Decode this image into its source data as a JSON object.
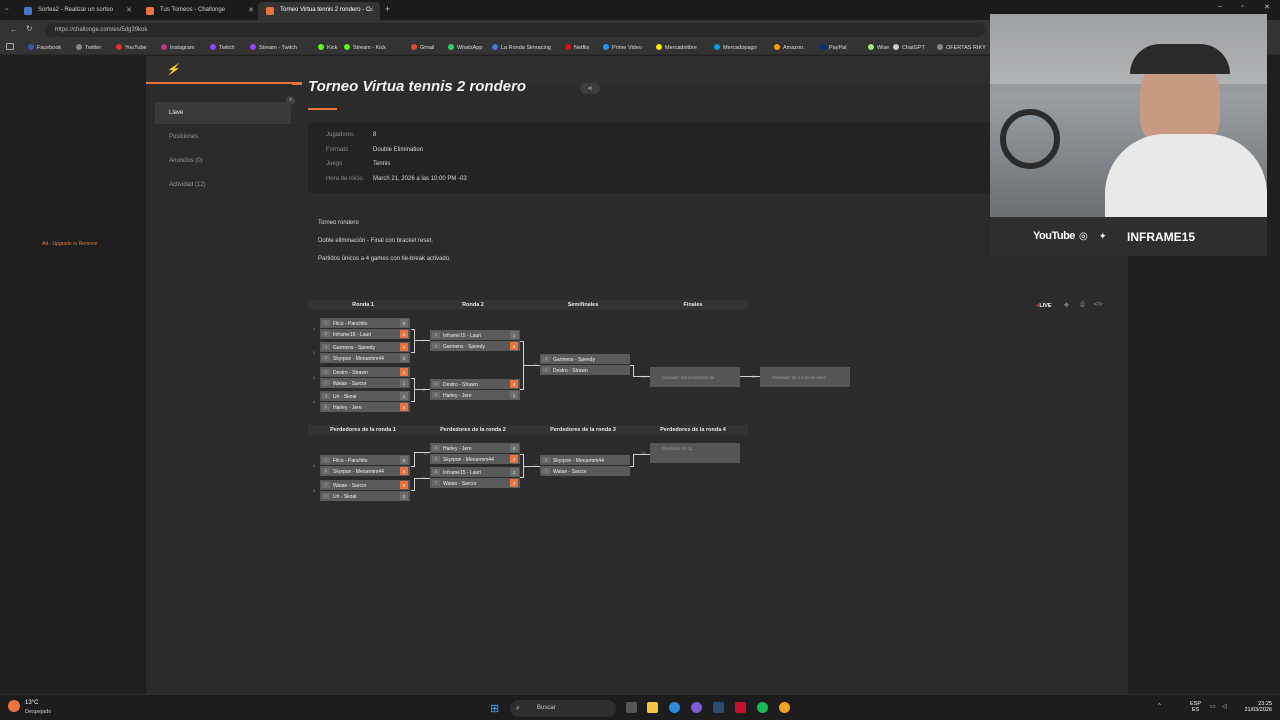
{
  "tabs": [
    {
      "label": "Sortea2 - Realizar un sorteo",
      "color": "#4a74c9"
    },
    {
      "label": "Tus Torneos - Challonge",
      "color": "#e8743b"
    },
    {
      "label": "Torneo Virtua tennis 2 rondero - C",
      "color": "#e8743b"
    }
  ],
  "url": "https://challonge.com/es/5dg39kok",
  "bookmarks": [
    {
      "label": "Facebook",
      "color": "#3b5998"
    },
    {
      "label": "Twitter",
      "color": "#888888"
    },
    {
      "label": "YouTube",
      "color": "#e52d27"
    },
    {
      "label": "Instagram",
      "color": "#c13584"
    },
    {
      "label": "Twitch",
      "color": "#9146ff"
    },
    {
      "label": "Stream - Twitch",
      "color": "#9146ff"
    },
    {
      "label": "Kick",
      "color": "#53fc18"
    },
    {
      "label": "Stream - Kick",
      "color": "#53fc18"
    },
    {
      "label": "Gmail",
      "color": "#ea4335"
    },
    {
      "label": "WhatsApp",
      "color": "#25d366"
    },
    {
      "label": "La Ronda Simracing",
      "color": "#4a74c9"
    },
    {
      "label": "Netflix",
      "color": "#e50914"
    },
    {
      "label": "Prime Video",
      "color": "#1a98ff"
    },
    {
      "label": "Mercadolibre",
      "color": "#ffe600"
    },
    {
      "label": "Mercadopago",
      "color": "#009ee3"
    },
    {
      "label": "Amazon.",
      "color": "#ff9900"
    },
    {
      "label": "PayPal",
      "color": "#003087"
    },
    {
      "label": "Wise",
      "color": "#9fe870"
    },
    {
      "label": "ChatGPT",
      "color": "#cccccc"
    },
    {
      "label": "OFERTAS RIKY",
      "color": "#888888"
    }
  ],
  "tournament": {
    "title": "Torneo Virtua tennis 2 rondero",
    "nav": [
      "Llave",
      "Posiciones",
      "Anuncios (0)",
      "Actividad (12)"
    ],
    "ad_text": "Ad - Upgrade to Remove",
    "info": [
      {
        "label": "Jugadores",
        "value": "8"
      },
      {
        "label": "Formato",
        "value": "Double Elimination"
      },
      {
        "label": "Juego",
        "value": "Tennis"
      },
      {
        "label": "Hora de inicio",
        "value": "March 21, 2026 a las 10:00 PM -03"
      }
    ],
    "description": [
      "Torneo rondero",
      "Doble eliminación - Final con bracket reset.",
      "Partidos únicos a 4 games con tie-break activado."
    ],
    "live_label": "LIVE"
  },
  "bracket": {
    "winners_rounds": [
      "Ronda 1",
      "Ronda 2",
      "Semifinales",
      "Finales"
    ],
    "losers_rounds": [
      "Perdedores de la ronda 1",
      "Perdedores de la ronda 2",
      "Perdedores de la ronda 3",
      "Perdedores de la ronda 4"
    ],
    "winners": [
      {
        "num": "1",
        "top": {
          "seed": "1",
          "name": "Filco - Panchito",
          "score": "0",
          "win": false
        },
        "bot": {
          "seed": "8",
          "name": "Inframe15 - Lauri",
          "score": "4",
          "win": true
        }
      },
      {
        "num": "2",
        "top": {
          "seed": "4",
          "name": "Garmens - Speedy",
          "score": "4",
          "win": true
        },
        "bot": {
          "seed": "5",
          "name": "Skyrpon - Meruemm44",
          "score": "0",
          "win": false
        }
      },
      {
        "num": "3",
        "top": {
          "seed": "2",
          "name": "Destro - Strawn",
          "score": "4",
          "win": true
        },
        "bot": {
          "seed": "7",
          "name": "Watan - Sarcor",
          "score": "1",
          "win": false
        }
      },
      {
        "num": "4",
        "top": {
          "seed": "3",
          "name": "Uri - Skoal",
          "score": "3",
          "win": false
        },
        "bot": {
          "seed": "6",
          "name": "Harley - Jere",
          "score": "4",
          "win": true
        }
      },
      {
        "num": "7",
        "top": {
          "seed": "8",
          "name": "Inframe15 - Lauri",
          "score": "1",
          "win": false
        },
        "bot": {
          "seed": "4",
          "name": "Garmens - Speedy",
          "score": "4",
          "win": true
        }
      },
      {
        "num": "8",
        "top": {
          "seed": "2",
          "name": "Destro - Strawn",
          "score": "4",
          "win": true
        },
        "bot": {
          "seed": "6",
          "name": "Harley - Jere",
          "score": "1",
          "win": false
        }
      },
      {
        "num": "11",
        "top": {
          "seed": "4",
          "name": "Garmens - Speedy",
          "score": "",
          "win": false
        },
        "bot": {
          "seed": "2",
          "name": "Destro - Strawn",
          "score": "",
          "win": false
        }
      }
    ],
    "finals": [
      {
        "num": "14",
        "text": "Ganador del cuadrante de"
      },
      {
        "num": "15",
        "text": "Perdedor de 14 (si es nece"
      }
    ],
    "losers": [
      {
        "num": "5",
        "top": {
          "seed": "1",
          "name": "Filco - Panchito",
          "score": "0",
          "win": false
        },
        "bot": {
          "seed": "5",
          "name": "Skyrpon - Meruemm44",
          "score": "4",
          "win": true
        }
      },
      {
        "num": "6",
        "top": {
          "seed": "7",
          "name": "Watan - Sarcor",
          "score": "4",
          "win": true
        },
        "bot": {
          "seed": "3",
          "name": "Uri - Skoal",
          "score": "3",
          "win": false
        }
      },
      {
        "num": "10",
        "top": {
          "seed": "6",
          "name": "Harley - Jere",
          "score": "0",
          "win": false
        },
        "bot": {
          "seed": "5",
          "name": "Skyrpon - Meruemm44",
          "score": "4",
          "win": true
        }
      },
      {
        "num": "9",
        "top": {
          "seed": "8",
          "name": "Inframe15 - Lauri",
          "score": "3",
          "win": false
        },
        "bot": {
          "seed": "7",
          "name": "Watan - Sarcor",
          "score": "4",
          "win": true
        }
      },
      {
        "num": "12",
        "top": {
          "seed": "5",
          "name": "Skyrpon - Meruemm44",
          "score": "",
          "win": false
        },
        "bot": {
          "seed": "7",
          "name": "Watan - Sarcor",
          "score": "",
          "win": false
        }
      }
    ],
    "losers_pending": {
      "num": "13",
      "text": "Perdedor de 11"
    }
  },
  "stream_overlay": {
    "youtube": "YouTube",
    "handle": "INFRAME15"
  },
  "taskbar": {
    "temp": "13°C",
    "weather": "Despejado",
    "search": "Buscar",
    "lang": "ESP",
    "lang2": "ES",
    "time": "23:25",
    "date": "21/03/2026"
  }
}
